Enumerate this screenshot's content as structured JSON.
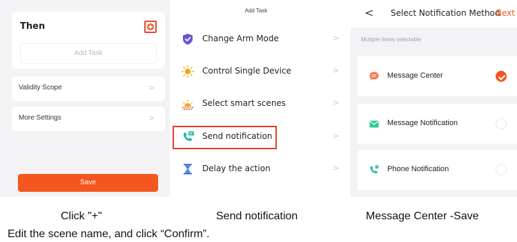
{
  "panel1": {
    "then_title": "Then",
    "add_task_placeholder": "Add Task",
    "rows": [
      {
        "label": "Validity Scope",
        "chevron": ">"
      },
      {
        "label": "More Settings",
        "chevron": ">"
      }
    ],
    "save_label": "Save",
    "colors": {
      "accent": "#f4561f",
      "highlight": "#e8452c"
    },
    "icons": {
      "add": "plus-circle-icon"
    }
  },
  "panel2": {
    "title": "Add Task",
    "items": [
      {
        "label": "Change Arm Mode",
        "icon": "shield-icon",
        "chevron": ">"
      },
      {
        "label": "Control Single Device",
        "icon": "sun-icon",
        "chevron": ">"
      },
      {
        "label": "Select smart scenes",
        "icon": "sunrise-icon",
        "chevron": ">"
      },
      {
        "label": "Send notification",
        "icon": "phone-message-icon",
        "chevron": ">"
      },
      {
        "label": "Delay the action",
        "icon": "hourglass-icon",
        "chevron": ">"
      }
    ],
    "highlighted_item": "Send notification"
  },
  "panel3": {
    "back": "<",
    "title": "Select Notification Method",
    "next": "Next",
    "hint": "Multiple items selectable",
    "options": [
      {
        "label": "Message Center",
        "icon": "chat-bubble-icon",
        "selected": true
      },
      {
        "label": "Message Notification",
        "icon": "envelope-icon",
        "selected": false
      },
      {
        "label": "Phone Notification",
        "icon": "phone-icon",
        "selected": false
      }
    ]
  },
  "captions": {
    "c1": "Click \"+\"",
    "c2": "Send notification",
    "c3": "Message Center -Save",
    "instruction": "Edit the scene name, and click “Confirm”."
  }
}
